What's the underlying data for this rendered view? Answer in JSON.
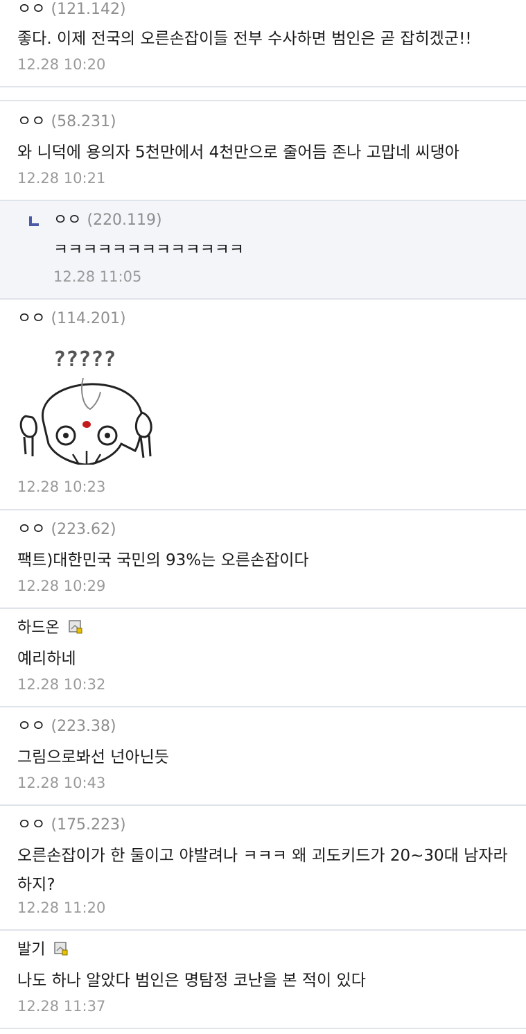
{
  "comments": [
    {
      "nick": "ㅇㅇ",
      "ip": "(121.142)",
      "text": "좋다. 이제 전국의 오른손잡이들 전부 수사하면 범인은 곧 잡히겠군!!",
      "date": "12.28 10:20"
    },
    {
      "nick": "ㅇㅇ",
      "ip": "(58.231)",
      "text": "와 니덕에 용의자 5천만에서 4천만으로 줄어듬 존나 고맙네 씨댕아",
      "date": "12.28 10:21"
    },
    {
      "nick": "ㅇㅇ",
      "ip": "(220.119)",
      "text": "ㅋㅋㅋㅋㅋㅋㅋㅋㅋㅋㅋㅋㅋ",
      "date": "12.28 11:05"
    },
    {
      "nick": "ㅇㅇ",
      "ip": "(114.201)",
      "sticker_text": "?????",
      "date": "12.28 10:23"
    },
    {
      "nick": "ㅇㅇ",
      "ip": "(223.62)",
      "text": "팩트)대한민국 국민의 93%는 오른손잡이다",
      "date": "12.28 10:29"
    },
    {
      "nick": "하드온",
      "icon": "member-badge-icon",
      "text": "예리하네",
      "date": "12.28 10:32"
    },
    {
      "nick": "ㅇㅇ",
      "ip": "(223.38)",
      "text": "그림으로봐선 넌아닌듯",
      "date": "12.28 10:43"
    },
    {
      "nick": "ㅇㅇ",
      "ip": "(175.223)",
      "text": "오른손잡이가 한 둘이고 야발려나 ㅋㅋㅋ 왜 괴도키드가 20~30대 남자라 하지?",
      "date": "12.28 11:20"
    },
    {
      "nick": "발기",
      "icon": "member-badge-icon",
      "text": "나도 하나 알았다 범인은 명탐정 코난을 본 적이 있다",
      "date": "12.28 11:37"
    }
  ],
  "colors": {
    "reply_bg": "#f3f5f9",
    "reply_mark": "#4a5aa6",
    "divider": "#dfe3ea",
    "meta": "#9a9a9a"
  }
}
